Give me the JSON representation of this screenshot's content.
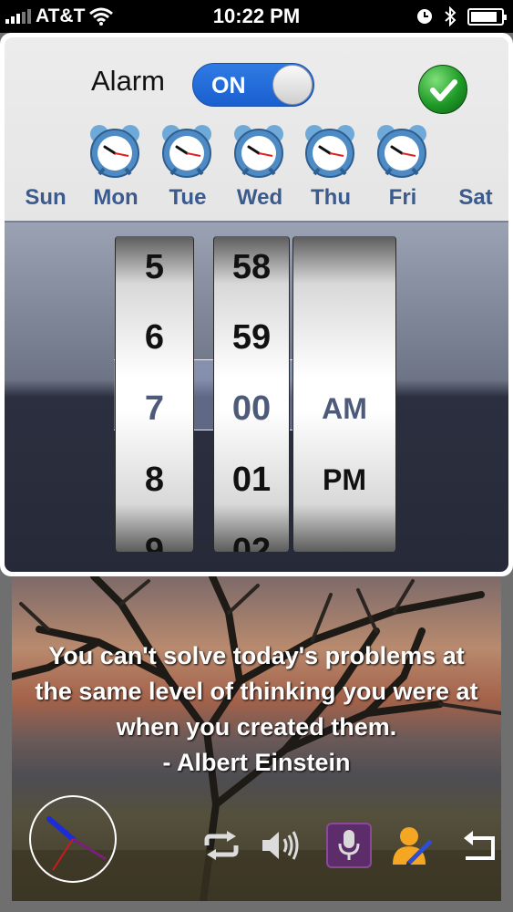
{
  "status": {
    "carrier": "AT&T",
    "time": "10:22 PM",
    "signal_bars": 5,
    "signal_active": 3
  },
  "alarm": {
    "label": "Alarm",
    "toggle": "ON",
    "accent": "#1f66d8",
    "days": [
      {
        "name": "Sun",
        "enabled": false
      },
      {
        "name": "Mon",
        "enabled": true
      },
      {
        "name": "Tue",
        "enabled": true
      },
      {
        "name": "Wed",
        "enabled": true
      },
      {
        "name": "Thu",
        "enabled": true
      },
      {
        "name": "Fri",
        "enabled": true
      },
      {
        "name": "Sat",
        "enabled": false
      }
    ]
  },
  "picker": {
    "hours": [
      "5",
      "6",
      "7",
      "8",
      "9"
    ],
    "minutes": [
      "58",
      "59",
      "00",
      "01",
      "02"
    ],
    "ampm": [
      "",
      "",
      "AM",
      "PM",
      ""
    ],
    "selected": {
      "hour": "7",
      "minute": "00",
      "ampm": "AM"
    }
  },
  "quote": {
    "text": "You can't solve today's problems at the same level of thinking you were at when you created them.",
    "author": "- Albert Einstein"
  },
  "toolbar": {
    "icons": [
      "repeat-icon",
      "speaker-icon",
      "microphone-icon",
      "user-edit-icon",
      "return-icon"
    ]
  }
}
